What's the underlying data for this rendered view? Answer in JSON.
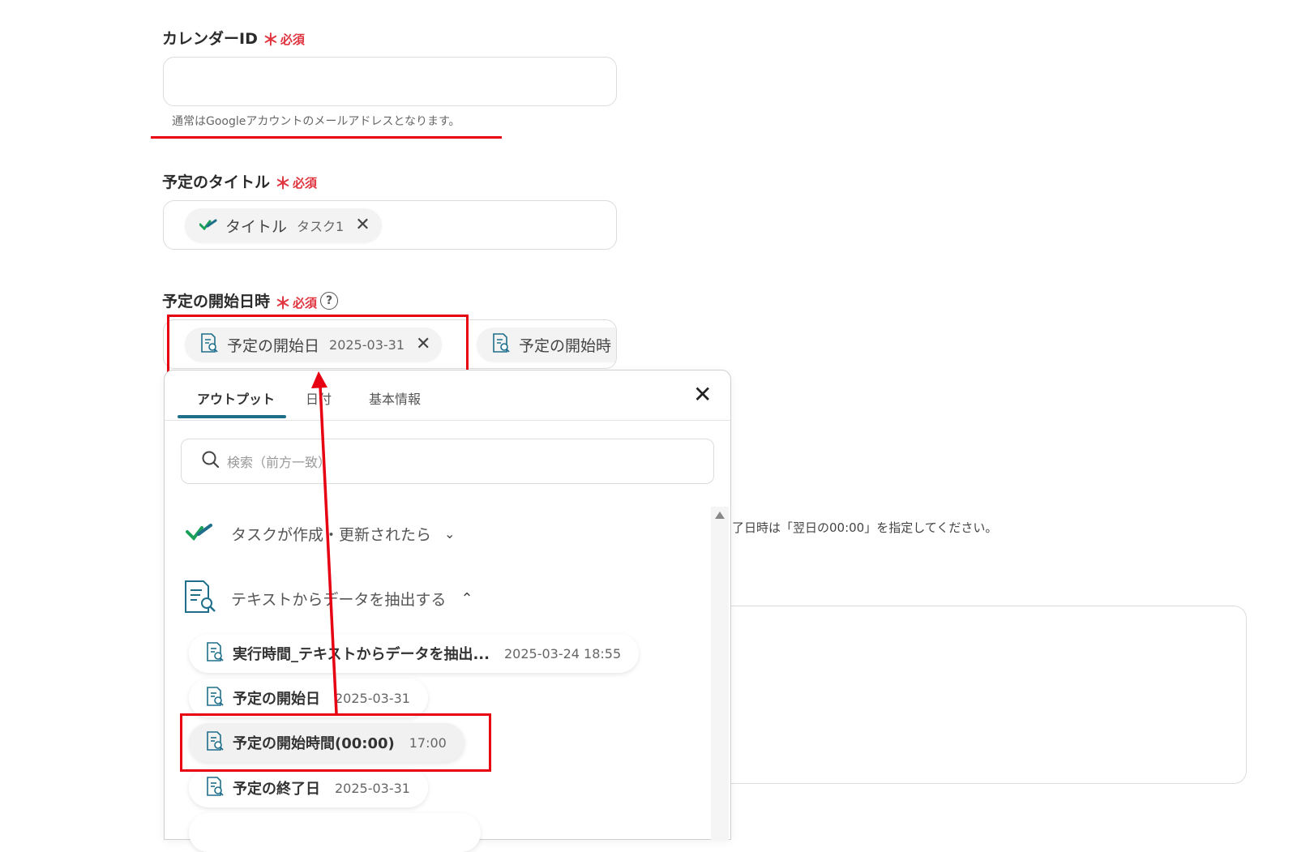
{
  "calendar_id": {
    "label": "カレンダーID",
    "required_mark": "＊",
    "required_label": "必須",
    "value": "",
    "hint": "通常はGoogleアカウントのメールアドレスとなります。"
  },
  "event_title": {
    "label": "予定のタイトル",
    "required_mark": "＊",
    "required_label": "必須",
    "chip": {
      "name": "タイトル",
      "value": "タスク1",
      "remove": "✕"
    }
  },
  "event_start": {
    "label": "予定の開始日時",
    "required_mark": "＊",
    "required_label": "必須",
    "help": "?",
    "chips": [
      {
        "name": "予定の開始日",
        "value": "2025-03-31",
        "remove": "✕"
      },
      {
        "name": "予定の開始時"
      }
    ]
  },
  "background_hint": "了日時は「翌日の00:00」を指定してください。",
  "popup": {
    "tabs": [
      "アウトプット",
      "日付",
      "基本情報"
    ],
    "active_tab": "アウトプット",
    "close": "✕",
    "search_placeholder": "検索（前方一致）",
    "groups": [
      {
        "title": "タスクが作成・更新されたら",
        "expanded": false,
        "icon": "check-logo-icon"
      },
      {
        "title": "テキストからデータを抽出する",
        "expanded": true,
        "icon": "document-search-icon"
      }
    ],
    "items": [
      {
        "name": "実行時間_テキストからデータを抽出...",
        "value": "2025-03-24 18:55"
      },
      {
        "name": "予定の開始日",
        "value": "2025-03-31"
      },
      {
        "name": "予定の開始時間(00:00)",
        "value": "17:00"
      },
      {
        "name": "予定の終了日",
        "value": "2025-03-31"
      }
    ]
  },
  "colors": {
    "required": "#e0343f",
    "annotation_red": "#e60012",
    "tab_underline": "#1f6f8b",
    "icon_teal": "#1f6f8b",
    "check_green": "#1aa05a"
  }
}
